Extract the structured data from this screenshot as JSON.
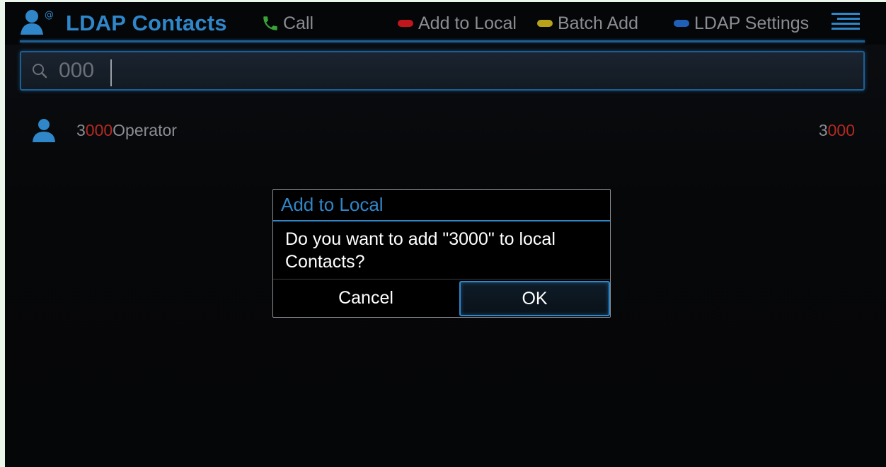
{
  "header": {
    "title": "LDAP Contacts",
    "accent_color": "#2f86c9",
    "softkeys": [
      {
        "label": "Call",
        "icon": "phone-handset-icon",
        "color": "#3aa236"
      },
      {
        "label": "Add to Local",
        "icon": "red-key-icon",
        "color": "#c0161c"
      },
      {
        "label": "Batch Add",
        "icon": "yellow-key-icon",
        "color": "#b8a21a"
      },
      {
        "label": "LDAP Settings",
        "icon": "blue-key-icon",
        "color": "#1f5fb8"
      }
    ],
    "menu_icon": "menu-lines-icon"
  },
  "search": {
    "value": "000",
    "icon": "search-icon"
  },
  "contacts": [
    {
      "name_prefix": "3",
      "name_match": "000",
      "name_suffix": "Operator",
      "number_prefix": "3",
      "number_match": "000",
      "avatar_icon": "person-icon"
    }
  ],
  "dialog": {
    "title": "Add to Local",
    "message": "Do you want to add \"3000\" to local Contacts?",
    "cancel_label": "Cancel",
    "ok_label": "OK"
  }
}
